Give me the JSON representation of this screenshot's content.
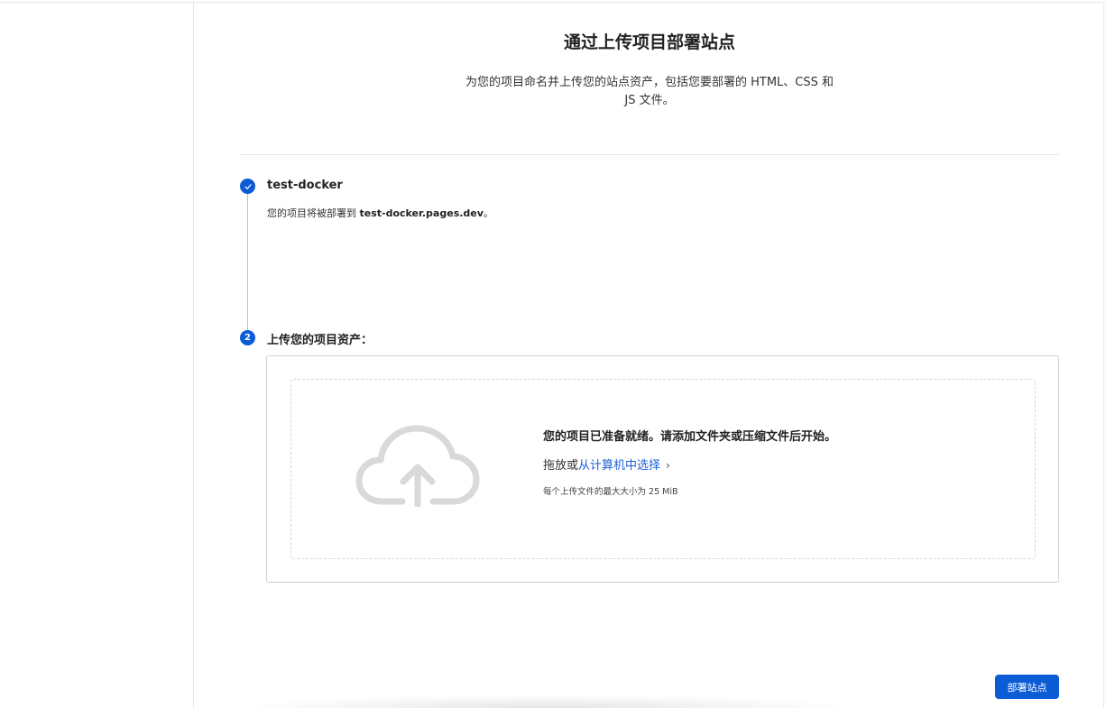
{
  "header": {
    "title": "通过上传项目部署站点",
    "subtitle": "为您的项目命名并上传您的站点资产，包括您要部署的 HTML、CSS 和 JS 文件。"
  },
  "steps": [
    {
      "number": "✓",
      "title": "test-docker",
      "desc_prefix": "您的项目将被部署到 ",
      "desc_domain": "test-docker.pages.dev",
      "desc_suffix": "。"
    },
    {
      "number": "2",
      "title": "上传您的项目资产："
    }
  ],
  "upload": {
    "ready_text": "您的项目已准备就绪。请添加文件夹或压缩文件后开始。",
    "drag_text": "拖放或",
    "select_link": "从计算机中选择",
    "chevron": "›",
    "size_note": "每个上传文件的最大大小为 25 MiB",
    "icon": "cloud-upload-icon"
  },
  "actions": {
    "deploy_label": "部署站点"
  },
  "colors": {
    "accent": "#0b5cd5",
    "link": "#1a5fd6",
    "icon_gray": "#d9d9d9"
  }
}
